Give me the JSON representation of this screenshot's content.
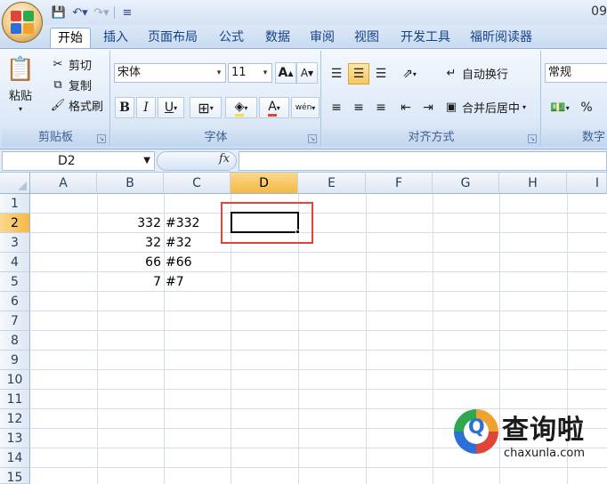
{
  "titlebar": {
    "title_fragment": "09"
  },
  "tabs": [
    "开始",
    "插入",
    "页面布局",
    "公式",
    "数据",
    "审阅",
    "视图",
    "开发工具",
    "福昕阅读器"
  ],
  "clipboard": {
    "paste": "粘贴",
    "cut": "剪切",
    "copy": "复制",
    "format_painter": "格式刷",
    "label": "剪贴板"
  },
  "font": {
    "name": "宋体",
    "size": "11",
    "label": "字体",
    "bold": "B",
    "italic": "I",
    "underline": "U",
    "grow": "A",
    "shrink": "A",
    "font_color": "A",
    "phonetic": "wén"
  },
  "alignment": {
    "wrap": "自动换行",
    "merge": "合并后居中",
    "label": "对齐方式"
  },
  "number": {
    "format": "常规",
    "percent": "%",
    "label": "数字"
  },
  "formula_bar": {
    "name_box": "D2",
    "fx": "fx",
    "content": ""
  },
  "columns": [
    "A",
    "B",
    "C",
    "D",
    "E",
    "F",
    "G",
    "H",
    "I"
  ],
  "rows": [
    "1",
    "2",
    "3",
    "4",
    "5",
    "6",
    "7",
    "8",
    "9",
    "10",
    "11",
    "12",
    "13",
    "14",
    "15"
  ],
  "cells": {
    "B2": "332",
    "C2": "#332",
    "B3": "32",
    "C3": "#32",
    "B4": "66",
    "C4": "#66",
    "B5": "7",
    "C5": "#7"
  },
  "selected_cell": "D2",
  "watermark": {
    "name": "查询啦",
    "url": "chaxunla.com",
    "q": "Q"
  },
  "colors": {
    "accent": "#15428b",
    "selection_header": "#f5b944",
    "annotation": "#e0453c",
    "font_color_bar": "#e0453c",
    "fill_color_bar": "#f7e03a"
  }
}
